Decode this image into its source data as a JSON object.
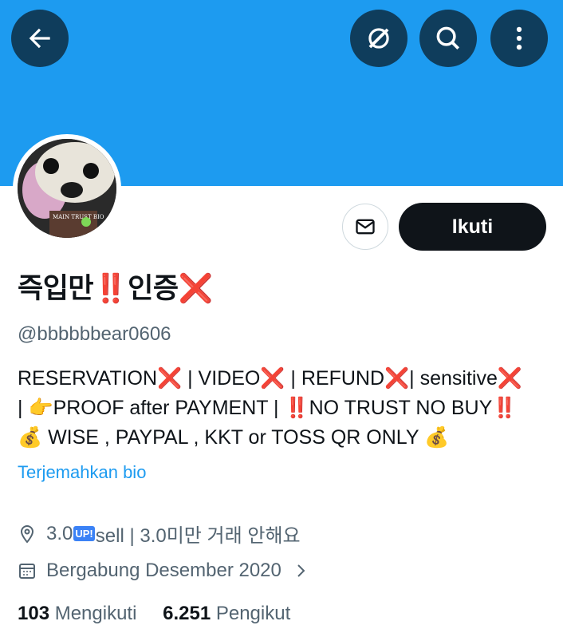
{
  "header": {
    "back_icon": "arrow-left-icon",
    "grok_icon": "grok-icon",
    "search_icon": "search-icon",
    "more_icon": "more-vertical-icon",
    "banner_color": "#1d9bf0"
  },
  "profile": {
    "avatar_text": "MAIN TRUST BIO",
    "name": "즉입만‼️인증❌",
    "handle": "@bbbbbbear0606",
    "follow_label": "Ikuti",
    "bio_lines": [
      "RESERVATION❌ | VIDEO❌ | REFUND❌| sensitive❌",
      "| 👉PROOF after PAYMENT | ‼️NO TRUST NO BUY‼️",
      "💰 WISE , PAYPAL , KKT or TOSS QR ONLY 💰"
    ],
    "translate_label": "Terjemahkan bio",
    "location_prefix": "3.0",
    "location_badge": "UP!",
    "location_suffix": "sell | 3.0미만 거래 안해요",
    "joined": "Bergabung Desember 2020",
    "following_count": "103",
    "following_label": "Mengikuti",
    "followers_count": "6.251",
    "followers_label": "Pengikut"
  }
}
